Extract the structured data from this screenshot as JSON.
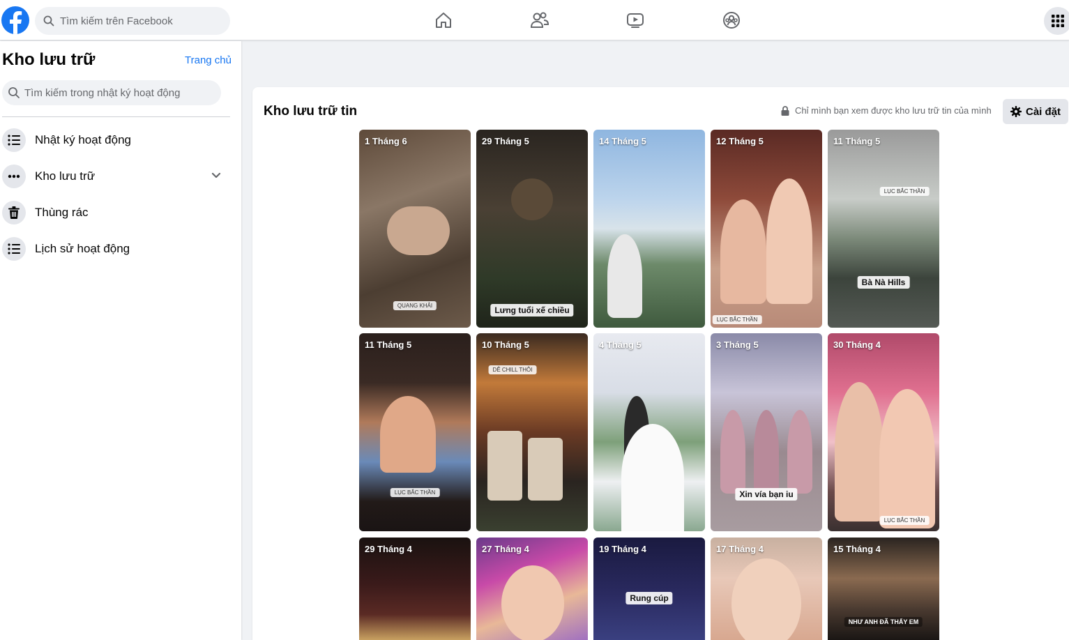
{
  "topbar": {
    "search_placeholder": "Tìm kiếm trên Facebook",
    "nav_icons": [
      "home-icon",
      "friends-icon",
      "watch-icon",
      "groups-icon"
    ],
    "menu_icon": "grid-menu-icon"
  },
  "sidebar": {
    "title": "Kho lưu trữ",
    "home_link": "Trang chủ",
    "search_placeholder": "Tìm kiếm trong nhật ký hoạt động",
    "items": [
      {
        "label": "Nhật ký hoạt động",
        "icon": "list-icon"
      },
      {
        "label": "Kho lưu trữ",
        "icon": "more-icon"
      },
      {
        "label": "Thùng rác",
        "icon": "trash-icon"
      },
      {
        "label": "Lịch sử hoạt động",
        "icon": "list-icon"
      }
    ]
  },
  "main": {
    "title": "Kho lưu trữ tin",
    "privacy_note": "Chỉ mình bạn xem được kho lưu trữ tin của mình",
    "settings_label": "Cài đặt",
    "stories": [
      {
        "date": "1 Tháng 6",
        "caption": "",
        "chip": "QUANG KHẢI"
      },
      {
        "date": "29 Tháng 5",
        "caption": "Lưng tuổi xế chiều",
        "chip": ""
      },
      {
        "date": "14 Tháng 5",
        "caption": "",
        "chip": ""
      },
      {
        "date": "12 Tháng 5",
        "caption": "",
        "chip": "LỤC BẮC THẦN"
      },
      {
        "date": "11 Tháng 5",
        "caption": "Bà Nà Hills",
        "chip": "LỤC BẮC THẦN"
      },
      {
        "date": "11 Tháng 5",
        "caption": "",
        "chip": "LỤC BẮC THẦN"
      },
      {
        "date": "10 Tháng 5",
        "caption": "",
        "chip": "DỄ CHILL THÔI"
      },
      {
        "date": "4 Tháng 5",
        "caption": "",
        "chip": ""
      },
      {
        "date": "3 Tháng 5",
        "caption": "Xin vía bạn iu",
        "chip": ""
      },
      {
        "date": "30 Tháng 4",
        "caption": "",
        "chip": "LỤC BẮC THẦN"
      },
      {
        "date": "29 Tháng 4",
        "caption": "",
        "chip": ""
      },
      {
        "date": "27 Tháng 4",
        "caption": "",
        "chip": ""
      },
      {
        "date": "19 Tháng 4",
        "caption": "Rung cúp",
        "chip": ""
      },
      {
        "date": "17 Tháng 4",
        "caption": "",
        "chip": ""
      },
      {
        "date": "15 Tháng 4",
        "caption": "NHƯ ANH ĐÃ THẤY EM",
        "chip": ""
      }
    ]
  },
  "colors": {
    "brand": "#1877f2",
    "page_bg": "#f0f2f5",
    "button_bg": "#e4e6eb",
    "secondary_text": "#65676b"
  }
}
